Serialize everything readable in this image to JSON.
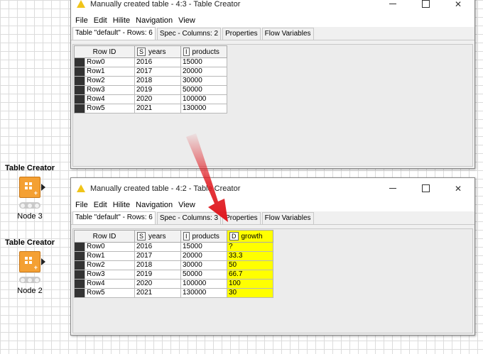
{
  "nodes": [
    {
      "title": "Table Creator",
      "label": "Node 3"
    },
    {
      "title": "Table Creator",
      "label": "Node 2"
    }
  ],
  "window_top": {
    "title": "Manually created table - 4:3 - Table Creator",
    "menu": [
      "File",
      "Edit",
      "Hilite",
      "Navigation",
      "View"
    ],
    "tabs": [
      "Table \"default\" - Rows: 6",
      "Spec - Columns: 2",
      "Properties",
      "Flow Variables"
    ],
    "table": {
      "row_id_header": "Row ID",
      "columns": [
        {
          "type": "S",
          "name": "years"
        },
        {
          "type": "I",
          "name": "products"
        }
      ],
      "rows": [
        {
          "id": "Row0",
          "years": "2016",
          "products": "15000"
        },
        {
          "id": "Row1",
          "years": "2017",
          "products": "20000"
        },
        {
          "id": "Row2",
          "years": "2018",
          "products": "30000"
        },
        {
          "id": "Row3",
          "years": "2019",
          "products": "50000"
        },
        {
          "id": "Row4",
          "years": "2020",
          "products": "100000"
        },
        {
          "id": "Row5",
          "years": "2021",
          "products": "130000"
        }
      ]
    }
  },
  "window_bottom": {
    "title": "Manually created table - 4:2 - Table Creator",
    "menu": [
      "File",
      "Edit",
      "Hilite",
      "Navigation",
      "View"
    ],
    "tabs": [
      "Table \"default\" - Rows: 6",
      "Spec - Columns: 3",
      "Properties",
      "Flow Variables"
    ],
    "table": {
      "row_id_header": "Row ID",
      "columns": [
        {
          "type": "S",
          "name": "years"
        },
        {
          "type": "I",
          "name": "products"
        },
        {
          "type": "D",
          "name": "growth"
        }
      ],
      "rows": [
        {
          "id": "Row0",
          "years": "2016",
          "products": "15000",
          "growth": "?"
        },
        {
          "id": "Row1",
          "years": "2017",
          "products": "20000",
          "growth": "33.3"
        },
        {
          "id": "Row2",
          "years": "2018",
          "products": "30000",
          "growth": "50"
        },
        {
          "id": "Row3",
          "years": "2019",
          "products": "50000",
          "growth": "66.7"
        },
        {
          "id": "Row4",
          "years": "2020",
          "products": "100000",
          "growth": "100"
        },
        {
          "id": "Row5",
          "years": "2021",
          "products": "130000",
          "growth": "30"
        }
      ]
    }
  },
  "colors": {
    "highlight": "#ffff00",
    "arrow": "#e0191f",
    "node": "#f4a033"
  },
  "icons": {
    "warning": "warning-triangle-icon",
    "node": "table-creator-icon"
  }
}
